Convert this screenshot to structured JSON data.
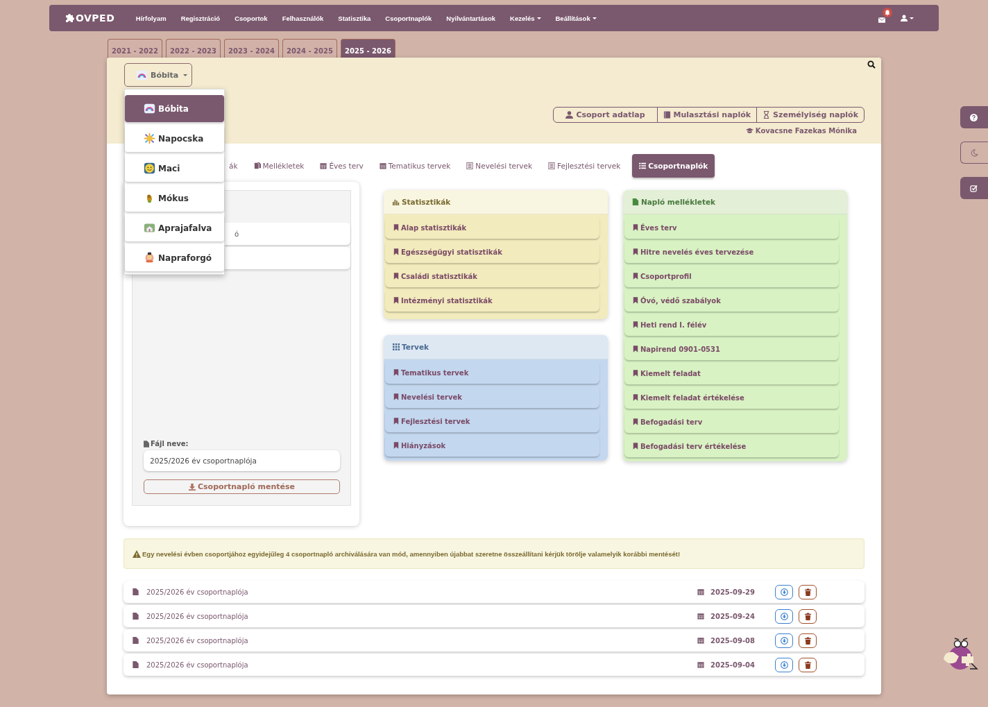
{
  "nav": {
    "logo": "OVPED",
    "items": [
      {
        "label": "Hírfolyam",
        "dropdown": false
      },
      {
        "label": "Regisztráció",
        "dropdown": false
      },
      {
        "label": "Csoportok",
        "dropdown": false
      },
      {
        "label": "Felhasználók",
        "dropdown": false
      },
      {
        "label": "Statisztika",
        "dropdown": false
      },
      {
        "label": "Csoportnaplók",
        "dropdown": false
      },
      {
        "label": "Nyilvántartások",
        "dropdown": false
      },
      {
        "label": "Kezelés",
        "dropdown": true
      },
      {
        "label": "Beállítások",
        "dropdown": true
      }
    ]
  },
  "years": [
    {
      "label": "2021 - 2022",
      "selected": false
    },
    {
      "label": "2022 - 2023",
      "selected": false
    },
    {
      "label": "2023 - 2024",
      "selected": false
    },
    {
      "label": "2024 - 2025",
      "selected": false
    },
    {
      "label": "2025 - 2026",
      "selected": true
    }
  ],
  "group_select": {
    "label": "Bóbita",
    "options": [
      {
        "label": "Bóbita",
        "selected": true
      },
      {
        "label": "Napocska",
        "selected": false
      },
      {
        "label": "Maci",
        "selected": false
      },
      {
        "label": "Mókus",
        "selected": false
      },
      {
        "label": "Aprajafalva",
        "selected": false
      },
      {
        "label": "Napraforgó",
        "selected": false
      }
    ]
  },
  "header_buttons": [
    "Csoport adatlap",
    "Mulasztási naplók",
    "Személyiség naplók"
  ],
  "teacher": "Kovacsne Fazekas Mónika",
  "tabs": [
    {
      "label": "ák",
      "selected": false
    },
    {
      "label": "Mellékletek",
      "selected": false
    },
    {
      "label": "Éves terv",
      "selected": false
    },
    {
      "label": "Tematikus tervek",
      "selected": false
    },
    {
      "label": "Nevelési tervek",
      "selected": false
    },
    {
      "label": "Fejlesztési tervek",
      "selected": false
    },
    {
      "label": "Csoportnaplók",
      "selected": true
    }
  ],
  "left_panel": {
    "items": [
      "ó"
    ],
    "file_label": "Fájl neve:",
    "file_value": "2025/2026 év csoportnaplója",
    "save_button": "Csoportnapló mentése"
  },
  "panels": [
    {
      "kind": "stats",
      "title": "Statisztikák",
      "items": [
        "Alap statisztikák",
        "Egészségügyi statisztikák",
        "Családi statisztikák",
        "Intézményi statisztikák"
      ]
    },
    {
      "kind": "plans",
      "title": "Tervek",
      "items": [
        "Tematikus tervek",
        "Nevelési tervek",
        "Fejlesztési tervek",
        "Hiányzások"
      ]
    },
    {
      "kind": "attachments",
      "title": "Napló mellékletek",
      "items": [
        "Éves terv",
        "Hitre nevelés éves tervezése",
        "Csoportprofil",
        "Óvó, védő szabályok",
        "Heti rend I. félév",
        "Napirend 0901-0531",
        "Kiemelt feladat",
        "Kiemelt feladat értékelése",
        "Befogadási terv",
        "Befogadási terv értékelése"
      ]
    }
  ],
  "warning": "Egy nevelési évben csoportjához egyidejűleg 4 csoportnapló archiválására van mód, amennyiben újabbat szeretne összeállítani kérjük törölje valamelyik korábbi mentését!",
  "files": [
    {
      "name": "2025/2026 év csoportnaplója",
      "date": "2025-09-29"
    },
    {
      "name": "2025/2026 év csoportnaplója",
      "date": "2025-09-24"
    },
    {
      "name": "2025/2026 év csoportnaplója",
      "date": "2025-09-08"
    },
    {
      "name": "2025/2026 év csoportnaplója",
      "date": "2025-09-04"
    }
  ]
}
